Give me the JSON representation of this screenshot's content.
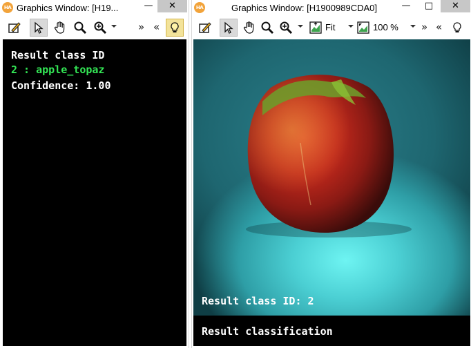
{
  "left_window": {
    "title": "Graphics Window: [H19...",
    "app_icon": "HA",
    "controls": {
      "minimize": "—",
      "maximize": "□",
      "close": "✕"
    },
    "toolbar": {
      "icons": [
        "edit-icon",
        "pointer-icon",
        "hand-icon",
        "magnifier-icon",
        "zoom-icon",
        "chevron-down-icon",
        "more-icon",
        "collapse-icon",
        "bulb-icon"
      ]
    },
    "result": {
      "line1": "Result class ID",
      "line2": "2 : apple_topaz",
      "line3": "Confidence: 1.00",
      "colors": {
        "label": "#ffffff",
        "class": "#33e655"
      }
    }
  },
  "right_window": {
    "title": "Graphics Window: [H1900989CDA0]",
    "app_icon": "HA",
    "controls": {
      "minimize": "—",
      "maximize": "□",
      "close": "✕"
    },
    "toolbar": {
      "fit_label": "Fit",
      "zoom_label": "100 %",
      "icons": [
        "edit-icon",
        "pointer-icon",
        "hand-icon",
        "magnifier-icon",
        "zoom-icon",
        "chevron-down-icon",
        "fit-icon",
        "zoom-level-icon",
        "more-icon",
        "collapse-icon",
        "bulb-icon"
      ]
    },
    "image_overlay": "Result class ID: 2",
    "bottom_label": "Result classification"
  }
}
